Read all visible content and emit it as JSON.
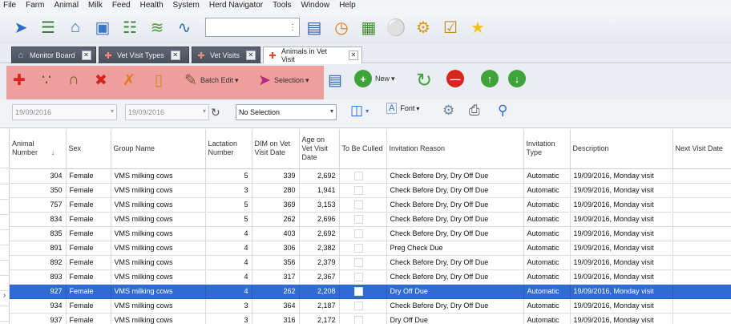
{
  "menu": [
    "File",
    "Farm",
    "Animal",
    "Milk",
    "Feed",
    "Health",
    "System",
    "Herd Navigator",
    "Tools",
    "Window",
    "Help"
  ],
  "tabs": [
    {
      "label": "Monitor Board",
      "active": false
    },
    {
      "label": "Vet Visit Types",
      "active": false
    },
    {
      "label": "Vet Visits",
      "active": false
    },
    {
      "label": "Animals in Vet Visit",
      "active": true
    }
  ],
  "toolbar2": {
    "batch_edit": "Batch Edit",
    "selection": "Selection",
    "new": "New",
    "font": "Font"
  },
  "filters": {
    "date_from": "19/09/2016",
    "date_to": "19/09/2016",
    "selection_value": "No Selection"
  },
  "grid": {
    "columns": [
      "Animal Number",
      "Sex",
      "Group Name",
      "Lactation Number",
      "DIM on Vet Visit Date",
      "Age on Vet Visit Date",
      "To Be Culled",
      "Invitation Reason",
      "Invitation Type",
      "Description",
      "Next Visit Date"
    ],
    "rows": [
      [
        "304",
        "Female",
        "VMS milking cows",
        "5",
        "339",
        "2,692",
        "",
        "Check Before Dry, Dry Off Due",
        "Automatic",
        "19/09/2016, Monday visit",
        ""
      ],
      [
        "350",
        "Female",
        "VMS milking cows",
        "3",
        "280",
        "1,941",
        "",
        "Check Before Dry, Dry Off Due",
        "Automatic",
        "19/09/2016, Monday visit",
        ""
      ],
      [
        "757",
        "Female",
        "VMS milking cows",
        "5",
        "369",
        "3,153",
        "",
        "Check Before Dry, Dry Off Due",
        "Automatic",
        "19/09/2016, Monday visit",
        ""
      ],
      [
        "834",
        "Female",
        "VMS milking cows",
        "5",
        "262",
        "2,696",
        "",
        "Check Before Dry, Dry Off Due",
        "Automatic",
        "19/09/2016, Monday visit",
        ""
      ],
      [
        "835",
        "Female",
        "VMS milking cows",
        "4",
        "403",
        "2,692",
        "",
        "Check Before Dry, Dry Off Due",
        "Automatic",
        "19/09/2016, Monday visit",
        ""
      ],
      [
        "891",
        "Female",
        "VMS milking cows",
        "4",
        "306",
        "2,382",
        "",
        "Preg Check Due",
        "Automatic",
        "19/09/2016, Monday visit",
        ""
      ],
      [
        "892",
        "Female",
        "VMS milking cows",
        "4",
        "356",
        "2,379",
        "",
        "Check Before Dry, Dry Off Due",
        "Automatic",
        "19/09/2016, Monday visit",
        ""
      ],
      [
        "893",
        "Female",
        "VMS milking cows",
        "4",
        "317",
        "2,367",
        "",
        "Check Before Dry, Dry Off Due",
        "Automatic",
        "19/09/2016, Monday visit",
        ""
      ],
      [
        "927",
        "Female",
        "VMS milking cows",
        "4",
        "262",
        "2,208",
        "",
        "Dry Off Due",
        "Automatic",
        "19/09/2016, Monday visit",
        ""
      ],
      [
        "934",
        "Female",
        "VMS milking cows",
        "3",
        "364",
        "2,187",
        "",
        "Check Before Dry, Dry Off Due",
        "Automatic",
        "19/09/2016, Monday visit",
        ""
      ],
      [
        "937",
        "Female",
        "VMS milking cows",
        "3",
        "316",
        "2,172",
        "",
        "Dry Off Due",
        "Automatic",
        "19/09/2016, Monday visit",
        ""
      ]
    ],
    "selected_row": 8
  }
}
